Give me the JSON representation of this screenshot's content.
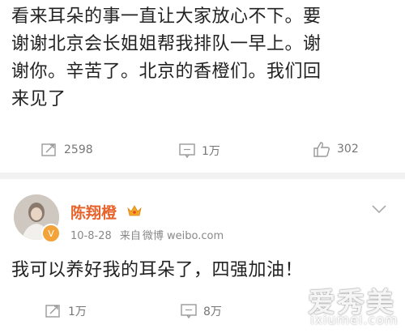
{
  "post": {
    "lines": [
      "看来耳朵的事一直让大家放心不下。要",
      "谢谢北京会长姐姐帮我排队一早上。谢",
      "谢你。辛苦了。北京的香橙们。我们回",
      "来见了"
    ],
    "repost_count": "2598",
    "comment_count": "1万",
    "like_count": "302"
  },
  "reply": {
    "username": "陈翔橙",
    "date": "10-8-28",
    "source_prefix": "来自",
    "source": "微博 weibo.com",
    "text": "我可以养好我的耳朵了，四强加油！",
    "repost_count": "1万",
    "comment_count": "8万"
  },
  "watermark": {
    "main": "爱秀美",
    "sub": "ixiumei.com"
  },
  "colors": {
    "username": "#e8632c",
    "verified_badge": "#f2a33a",
    "crown": "#f5a623"
  },
  "icons": [
    "repost-icon",
    "comment-icon",
    "like-icon",
    "chevron-down-icon",
    "crown-icon",
    "verified-icon"
  ]
}
